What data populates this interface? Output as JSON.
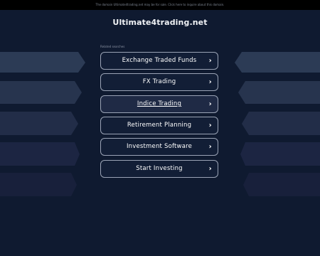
{
  "topbar": {
    "notice": "The domain Ultimate4trading.net may be for sale. Click here to inquire about this domain."
  },
  "header": {
    "site_title": "Ultimate4trading.net"
  },
  "related": {
    "heading": "Related searches",
    "items": [
      {
        "label": "Exchange Traded Funds"
      },
      {
        "label": "FX Trading"
      },
      {
        "label": "Indice Trading"
      },
      {
        "label": "Retirement Planning"
      },
      {
        "label": "Investment Software"
      },
      {
        "label": "Start Investing"
      }
    ]
  },
  "colors": {
    "background": "#0f1a30",
    "topbar": "#000000",
    "button_border": "#9aa3b5",
    "button_active": "#1f2a45"
  },
  "icons": {
    "chevron": "chevron-right-icon"
  }
}
